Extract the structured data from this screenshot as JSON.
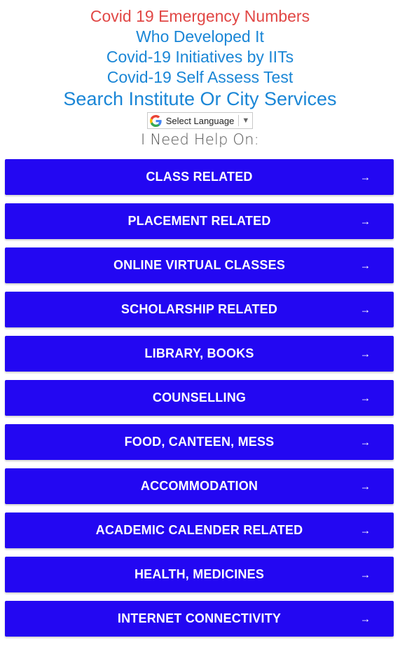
{
  "links": {
    "emergency": "Covid 19 Emergency Numbers",
    "developer": "Who Developed It",
    "initiatives": "Covid-19 Initiatives by IITs",
    "self_assess": "Covid-19 Self Assess Test",
    "search": "Search Institute Or City Services"
  },
  "translate": {
    "label": "Select Language",
    "caret": "▼"
  },
  "help_title": "I Need Help On:",
  "buttons": [
    {
      "label": "CLASS RELATED",
      "arrow": "→"
    },
    {
      "label": "PLACEMENT RELATED",
      "arrow": "→"
    },
    {
      "label": "ONLINE VIRTUAL CLASSES",
      "arrow": "→"
    },
    {
      "label": "SCHOLARSHIP RELATED",
      "arrow": "→"
    },
    {
      "label": "LIBRARY, BOOKS",
      "arrow": "→"
    },
    {
      "label": "COUNSELLING",
      "arrow": "→"
    },
    {
      "label": "FOOD, CANTEEN, MESS",
      "arrow": "→"
    },
    {
      "label": "ACCOMMODATION",
      "arrow": "→"
    },
    {
      "label": "ACADEMIC CALENDER RELATED",
      "arrow": "→"
    },
    {
      "label": "HEALTH, MEDICINES",
      "arrow": "→"
    },
    {
      "label": "INTERNET CONNECTIVITY",
      "arrow": "→"
    }
  ],
  "colors": {
    "button_bg": "#2307f2",
    "link_red": "#e14745",
    "link_blue": "#1a86d6"
  }
}
